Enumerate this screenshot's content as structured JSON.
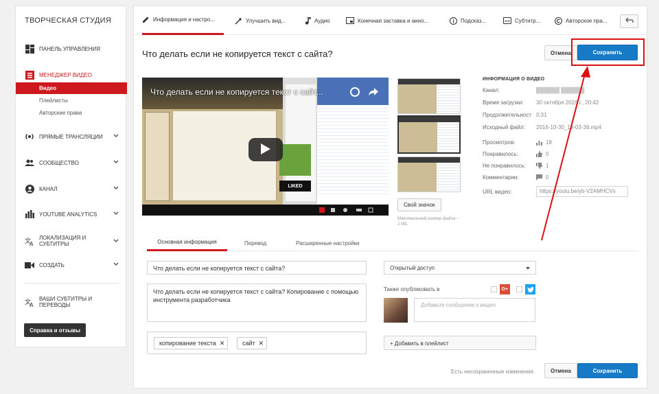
{
  "sidebar": {
    "title": "ТВОРЧЕСКАЯ СТУДИЯ",
    "dashboard": "ПАНЕЛЬ УПРАВЛЕНИЯ",
    "video_manager": "МЕНЕДЖЕР ВИДЕО",
    "video_manager_sub": [
      "Видео",
      "Плейлисты",
      "Авторские права"
    ],
    "live": "ПРЯМЫЕ ТРАНСЛЯЦИИ",
    "community": "СООБЩЕСТВО",
    "channel": "КАНАЛ",
    "analytics": "YOUTUBE ANALYTICS",
    "localization": "ЛОКАЛИЗАЦИЯ И СУБТИТРЫ",
    "create": "СОЗДАТЬ",
    "your_subtitles": "ВАШИ СУБТИТРЫ И ПЕРЕВОДЫ",
    "help_button": "Справка и отзывы"
  },
  "tabs": [
    {
      "label": "Информация и настро...",
      "icon": "pencil-icon"
    },
    {
      "label": "Улучшить вид...",
      "icon": "magic-wand-icon"
    },
    {
      "label": "Аудио",
      "icon": "music-note-icon"
    },
    {
      "label": "Конечная заставка и анно...",
      "icon": "end-screen-icon"
    },
    {
      "label": "Подсказ...",
      "icon": "info-card-icon"
    },
    {
      "label": "Субтитр...",
      "icon": "subtitles-icon"
    },
    {
      "label": "Авторское пра...",
      "icon": "copyright-icon"
    }
  ],
  "video_title": "Что делать если не копируется текст с сайта?",
  "buttons": {
    "cancel": "Отмена",
    "save": "Сохранить"
  },
  "player": {
    "title": "Что делать если не копируется текст с сайт...",
    "liked": "LIKED"
  },
  "custom_thumbnail": "Свой значок",
  "thumb_note": "Максимальный размер файла – 2 МБ.",
  "info": {
    "heading": "ИНФОРМАЦИЯ О ВИДЕО",
    "rows": [
      {
        "label": "Канал:",
        "value": "██████ ██████"
      },
      {
        "label": "Время загрузки:",
        "value": "30 октября 2016 г., 20:42"
      },
      {
        "label": "Продолжительност",
        "value": "0:31"
      },
      {
        "label": "Исходный файл:",
        "value": "2016-10-30_19-03-36.mp4"
      },
      {
        "label": "Просмотров:",
        "value": "18"
      },
      {
        "label": "Понравилось:",
        "value": "0"
      },
      {
        "label": "Не понравилось:",
        "value": "1"
      },
      {
        "label": "Комментарии:",
        "value": "0"
      },
      {
        "label": "URL видео:",
        "value": "https://youtu.be/yb-V2AMHCVs"
      }
    ]
  },
  "subtabs": [
    "Основная информация",
    "Перевод",
    "Расширенные настройки"
  ],
  "form": {
    "title_value": "Что делать если не копируется текст с сайта?",
    "description_value": "Что делать если не копируется текст с сайта? Копирование с помощью инструмента разработчика",
    "tags": [
      "копирование текста",
      "сайт"
    ],
    "privacy": "Открытый доступ",
    "also_publish": "Также опубликовать в",
    "message_placeholder": "Добавьте сообщение к видео",
    "add_playlist": "+ Добавить в плейлист",
    "gplus": "G+",
    "unsaved": "Есть несохраненные изменения."
  },
  "colors": {
    "accent_red": "#cc181e",
    "save_blue": "#167ac6",
    "annotation_red": "#dd1111"
  }
}
